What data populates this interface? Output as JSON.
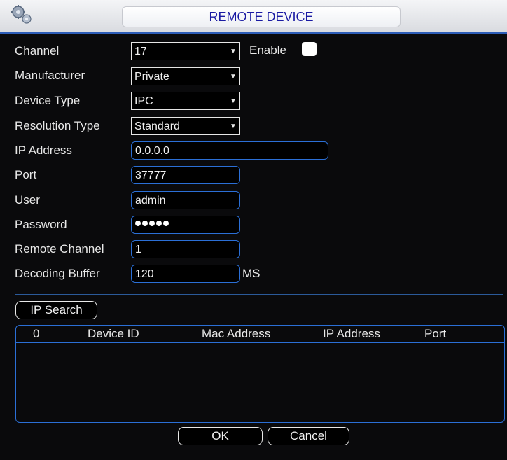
{
  "window": {
    "title": "REMOTE DEVICE",
    "icon": "gear-settings-icon"
  },
  "form": {
    "channel": {
      "label": "Channel",
      "value": "17"
    },
    "enable": {
      "label": "Enable",
      "checked": false
    },
    "manufacturer": {
      "label": "Manufacturer",
      "value": "Private"
    },
    "device_type": {
      "label": "Device Type",
      "value": "IPC"
    },
    "resolution_type": {
      "label": "Resolution Type",
      "value": "Standard"
    },
    "ip_address": {
      "label": "IP Address",
      "value": "0.0.0.0"
    },
    "port": {
      "label": "Port",
      "value": "37777"
    },
    "user": {
      "label": "User",
      "value": "admin"
    },
    "password": {
      "label": "Password",
      "masked_length": 5
    },
    "remote_channel": {
      "label": "Remote Channel",
      "value": "1"
    },
    "decoding_buffer": {
      "label": "Decoding Buffer",
      "value": "120",
      "unit": "MS"
    }
  },
  "search": {
    "button_label": "IP Search",
    "columns": [
      "0",
      "Device ID",
      "Mac Address",
      "IP Address",
      "Port"
    ],
    "rows": []
  },
  "actions": {
    "ok_label": "OK",
    "cancel_label": "Cancel"
  },
  "colors": {
    "background": "#0a0a0c",
    "accent_border": "#2b6fd6",
    "title_text": "#1a1aa3"
  }
}
